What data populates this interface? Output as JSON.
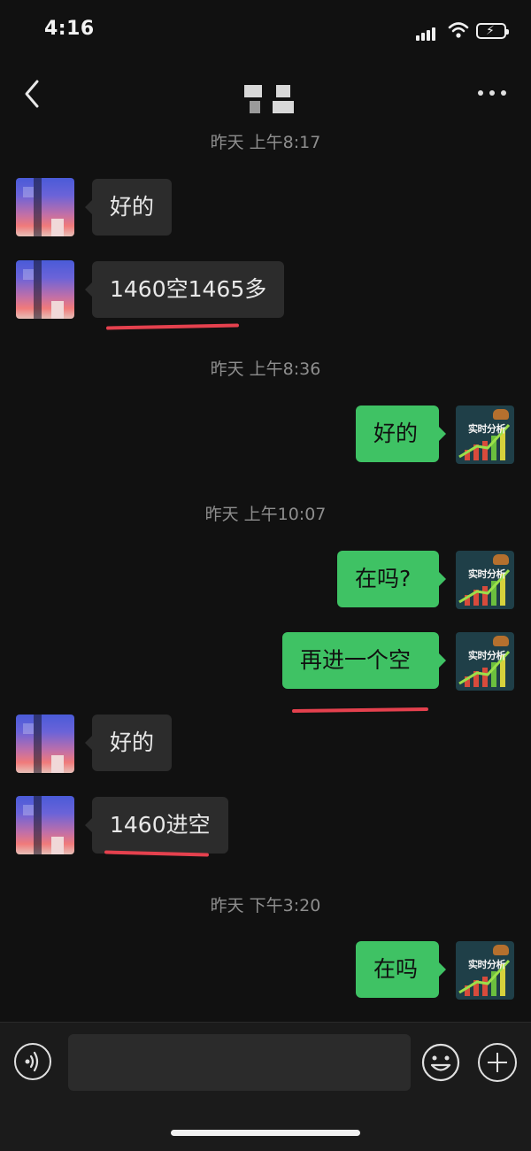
{
  "status_bar": {
    "time": "4:16"
  },
  "nav": {
    "icons": [
      "back-arrow-icon",
      "more-icon"
    ]
  },
  "messages": [
    {
      "type": "time",
      "text": "昨天 上午8:17"
    },
    {
      "type": "in",
      "text": "好的"
    },
    {
      "type": "in",
      "text": "1460空1465多",
      "underlined": true
    },
    {
      "type": "time",
      "text": "昨天 上午8:36"
    },
    {
      "type": "out",
      "text": "好的"
    },
    {
      "type": "time",
      "text": "昨天 上午10:07"
    },
    {
      "type": "out",
      "text": "在吗?"
    },
    {
      "type": "out",
      "text": "再进一个空",
      "underlined": true
    },
    {
      "type": "in",
      "text": "好的"
    },
    {
      "type": "in",
      "text": "1460进空",
      "underlined": true
    },
    {
      "type": "time",
      "text": "昨天 下午3:20"
    },
    {
      "type": "out",
      "text": "在吗"
    }
  ],
  "contact_avatar": {
    "text": "实时分析"
  },
  "input_bar": {
    "placeholder": "",
    "icons": [
      "voice-icon",
      "emoji-icon",
      "plus-icon"
    ]
  },
  "colors": {
    "background": "#111111",
    "incoming_bubble": "#2c2c2c",
    "outgoing_bubble": "#3fc264",
    "annotation_underline": "#e5414e"
  }
}
